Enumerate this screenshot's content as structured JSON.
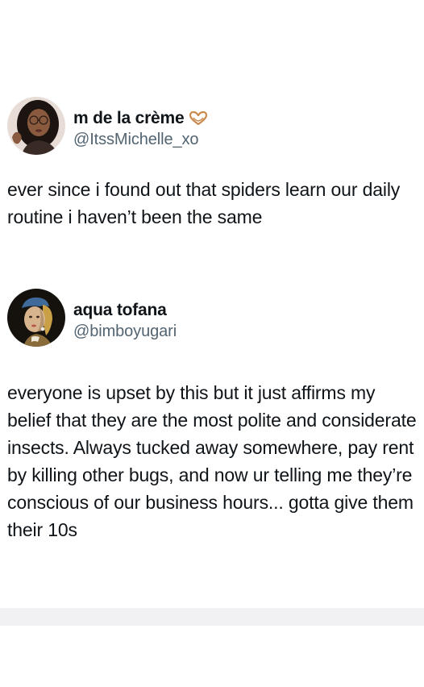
{
  "posts": [
    {
      "display_name": "m de la crème",
      "name_emoji": "heart-hands-icon",
      "handle": "@ItssMichelle_xo",
      "text": "ever since i found out that spiders learn our daily routine i haven’t been the same",
      "avatar": "profile-photo-woman-glasses"
    },
    {
      "display_name": "aqua tofana",
      "handle": "@bimboyugari",
      "text": "everyone is upset by this but it just affirms my belief that they are the most polite and considerate insects. Always tucked away somewhere, pay rent by killing other bugs, and now ur telling me they’re conscious of our business hours... gotta give them their 10s",
      "avatar": "girl-with-pearl-earring-painting"
    }
  ],
  "colors": {
    "name": "#0f1419",
    "handle": "#536471",
    "heart": "#c98b4e",
    "background": "#ffffff"
  }
}
